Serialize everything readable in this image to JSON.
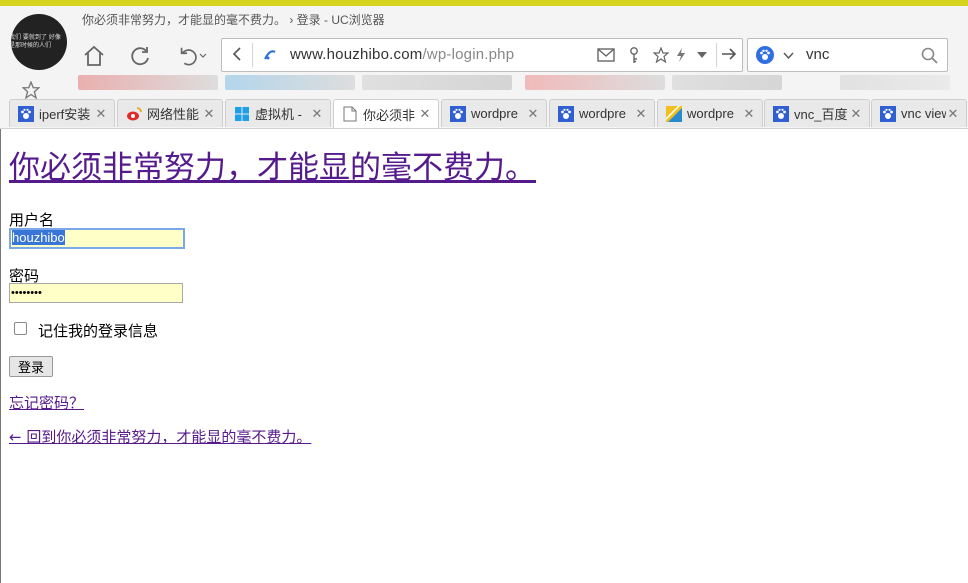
{
  "window": {
    "title": "你必须非常努力，才能显的毫不费力。 › 登录 - UC浏览器",
    "avatar_text": "我们 要就到了 好像是那时候的人们"
  },
  "address_bar": {
    "url_host": "www.houzhibo.com",
    "url_path": "/wp-login.php"
  },
  "search_bar": {
    "query": "vnc"
  },
  "tabs": [
    {
      "label": "iperf安装",
      "icon": "paw-icon",
      "active": false
    },
    {
      "label": "网络性能",
      "icon": "weibo-icon",
      "active": false
    },
    {
      "label": "虚拟机 -",
      "icon": "windows-icon",
      "active": false
    },
    {
      "label": "你必须非",
      "icon": "page-icon",
      "active": true
    },
    {
      "label": "wordpre",
      "icon": "paw-icon",
      "active": false
    },
    {
      "label": "wordpre",
      "icon": "paw-icon",
      "active": false
    },
    {
      "label": "wordpre",
      "icon": "stripe-icon",
      "active": false
    },
    {
      "label": "vnc_百度",
      "icon": "paw-icon",
      "active": false
    },
    {
      "label": "vnc view",
      "icon": "paw-icon",
      "active": false
    }
  ],
  "page": {
    "site_title": "你必须非常努力，才能显的毫不费力。",
    "username_label": "用户名",
    "username_value": "houzhibo",
    "password_label": "密码",
    "password_value": "••••••••",
    "remember_label": "记住我的登录信息",
    "login_button": "登录",
    "forgot_link": "忘记密码？",
    "back_link": "← 回到你必须非常努力，才能显的毫不费力。"
  },
  "colors": {
    "link": "#551a8b",
    "autofill": "#ffffc8",
    "selection": "#3875d7"
  }
}
